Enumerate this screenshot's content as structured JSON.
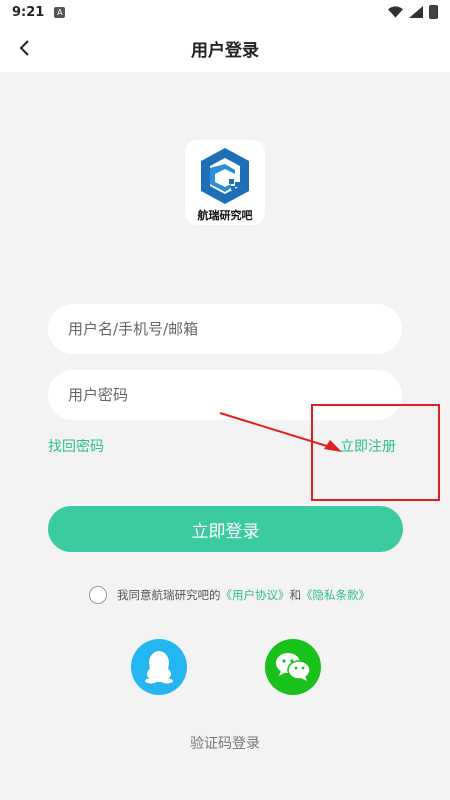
{
  "status_bar": {
    "time": "9:21",
    "notification_icon": "A"
  },
  "header": {
    "title": "用户登录",
    "back_icon": "chevron-left-icon"
  },
  "logo": {
    "text": "航瑞研究吧"
  },
  "form": {
    "username_placeholder": "用户名/手机号/邮箱",
    "password_placeholder": "用户密码",
    "forgot_label": "找回密码",
    "register_label": "立即注册",
    "login_label": "立即登录"
  },
  "agreement": {
    "prefix": "我同意航瑞研究吧的",
    "user_agreement": "《用户协议》",
    "and": "和",
    "privacy_policy": "《隐私条款》"
  },
  "social": {
    "qq_icon": "qq-icon",
    "wechat_icon": "wechat-icon"
  },
  "sms_login_label": "验证码登录",
  "colors": {
    "accent": "#3ccba1",
    "link": "#2ebc92",
    "annotation": "#e02020",
    "qq": "#24b6f0",
    "wechat": "#19c21a"
  }
}
